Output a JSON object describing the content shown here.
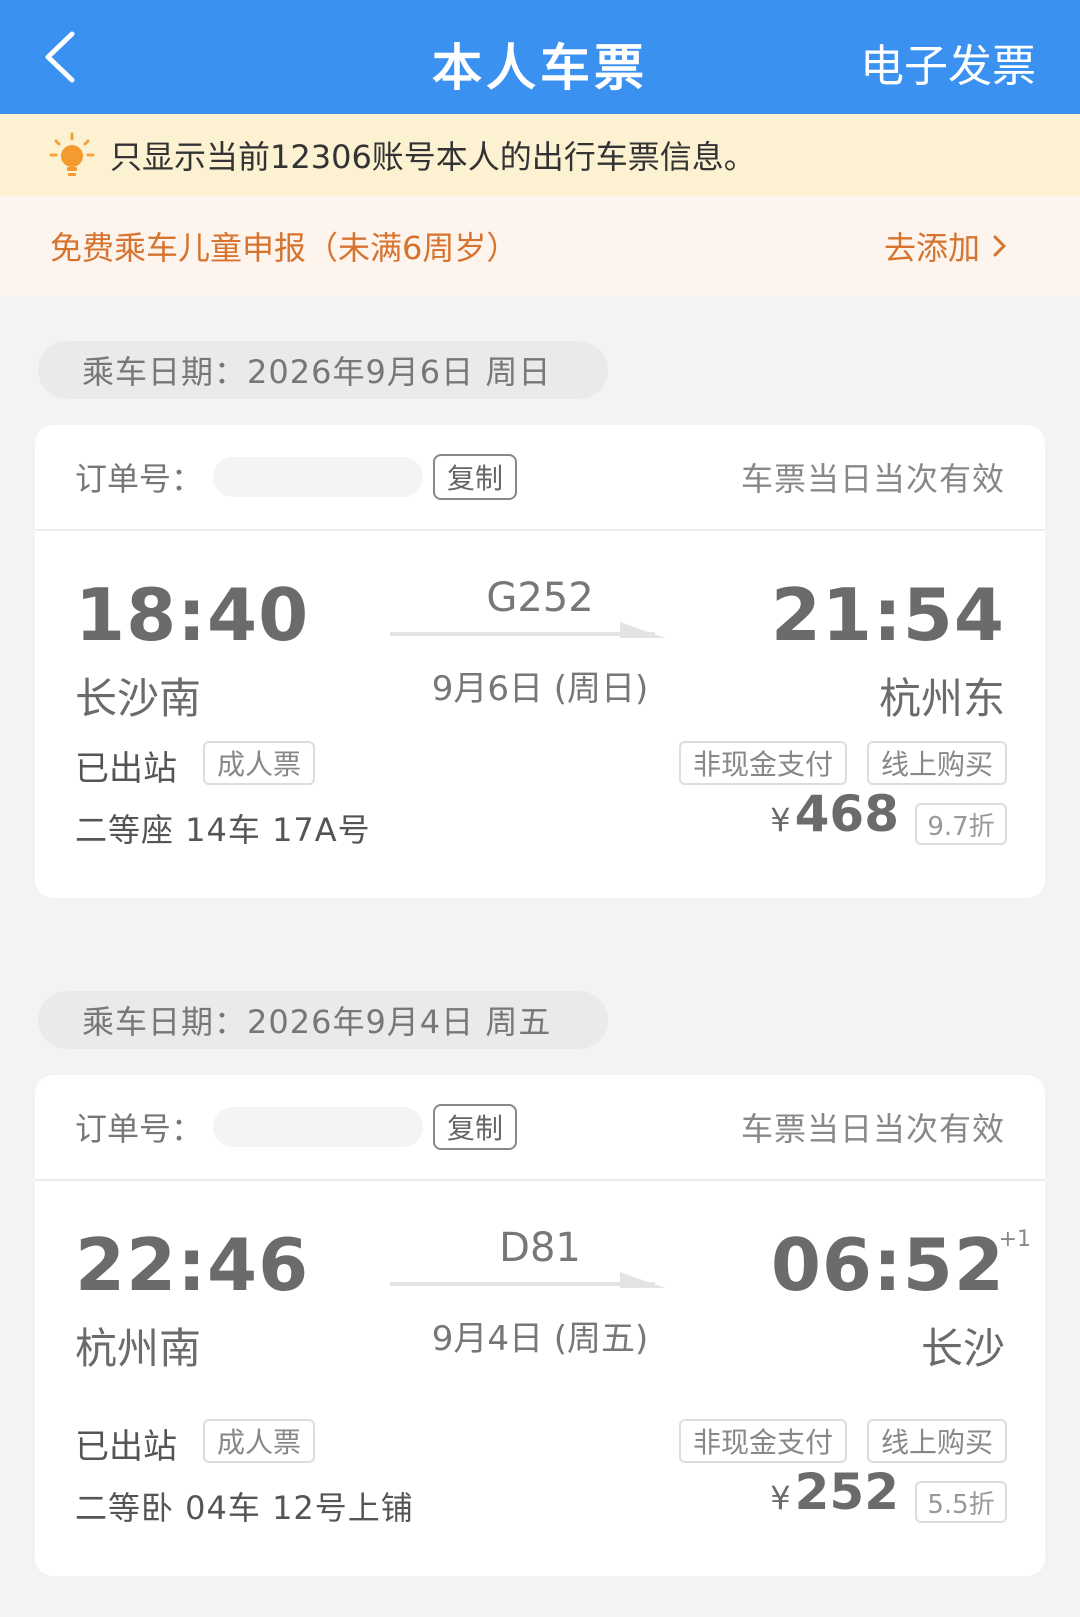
{
  "header": {
    "title": "本人车票",
    "invoice_label": "电子发票",
    "background": "#3b91f0"
  },
  "notice": {
    "text": "只显示当前12306账号本人的出行车票信息。",
    "icon": "bulb-icon"
  },
  "child_declaration": {
    "text": "免费乘车儿童申报（未满6周岁）",
    "action_label": "去添加",
    "accent_color": "#d6742f"
  },
  "tickets": [
    {
      "date_label": "乘车日期：2026年9月6日 周日",
      "order_label": "订单号：",
      "copy_label": "复制",
      "validity": "车票当日当次有效",
      "departure_time": "18:40",
      "departure_station": "长沙南",
      "train_number": "G252",
      "train_date": "9月6日 (周日)",
      "arrival_time": "21:54",
      "arrival_next_day": "",
      "arrival_station": "杭州东",
      "status": "已出站",
      "ticket_type": "成人票",
      "payment_tag": "非现金支付",
      "channel_tag": "线上购买",
      "seat": "二等座 14车 17A号",
      "currency": "¥",
      "price": "468",
      "discount": "9.7折"
    },
    {
      "date_label": "乘车日期：2026年9月4日 周五",
      "order_label": "订单号：",
      "copy_label": "复制",
      "validity": "车票当日当次有效",
      "departure_time": "22:46",
      "departure_station": "杭州南",
      "train_number": "D81",
      "train_date": "9月4日 (周五)",
      "arrival_time": "06:52",
      "arrival_next_day": "+1",
      "arrival_station": "长沙",
      "status": "已出站",
      "ticket_type": "成人票",
      "payment_tag": "非现金支付",
      "channel_tag": "线上购买",
      "seat": "二等卧 04车 12号上铺",
      "currency": "¥",
      "price": "252",
      "discount": "5.5折"
    }
  ]
}
